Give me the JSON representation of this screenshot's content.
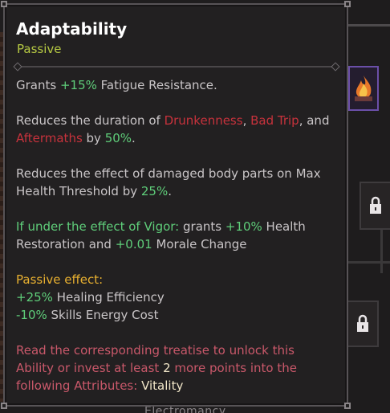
{
  "tooltip": {
    "title": "Adaptability",
    "subtitle": "Passive",
    "p1": {
      "a": "Grants ",
      "b": "+15%",
      "c": " Fatigue Resistance."
    },
    "p2": {
      "a": "Reduces the duration of ",
      "b": "Drunkenness",
      "c": ", ",
      "d": "Bad Trip",
      "e": ", and",
      "f": "Aftermaths",
      "g": " by ",
      "h": "50%",
      "i": "."
    },
    "p3": {
      "a": "Reduces the effect of damaged body parts on Max",
      "b": "Health Threshold by ",
      "c": "25%",
      "d": "."
    },
    "p4": {
      "a": "If under the effect of Vigor:",
      "b": " grants ",
      "c": "+10%",
      "d": " Health",
      "e": "Restoration and ",
      "f": "+0.01",
      "g": " Morale Change"
    },
    "p5": {
      "header": "Passive effect:",
      "l1a": "+25%",
      "l1b": " Healing Efficiency",
      "l2a": "-10%",
      "l2b": " Skills Energy Cost"
    },
    "p6": {
      "a": "Read the corresponding treatise to unlock this",
      "b": "Ability or invest at least ",
      "c": "2",
      "d": " more points into the",
      "e": "following Attributes: ",
      "f": "Vitality"
    }
  },
  "background": {
    "bottom_label": "Electromancy"
  },
  "colors": {
    "positive": "#5fce7a",
    "negative": "#c7323c",
    "passive_label": "#b6c943",
    "gold": "#e8b030",
    "locked_text": "#c9586a"
  },
  "icons": {
    "skill_fire": "fire-skill-icon",
    "locked_1": "lock-icon",
    "locked_2": "lock-icon"
  }
}
